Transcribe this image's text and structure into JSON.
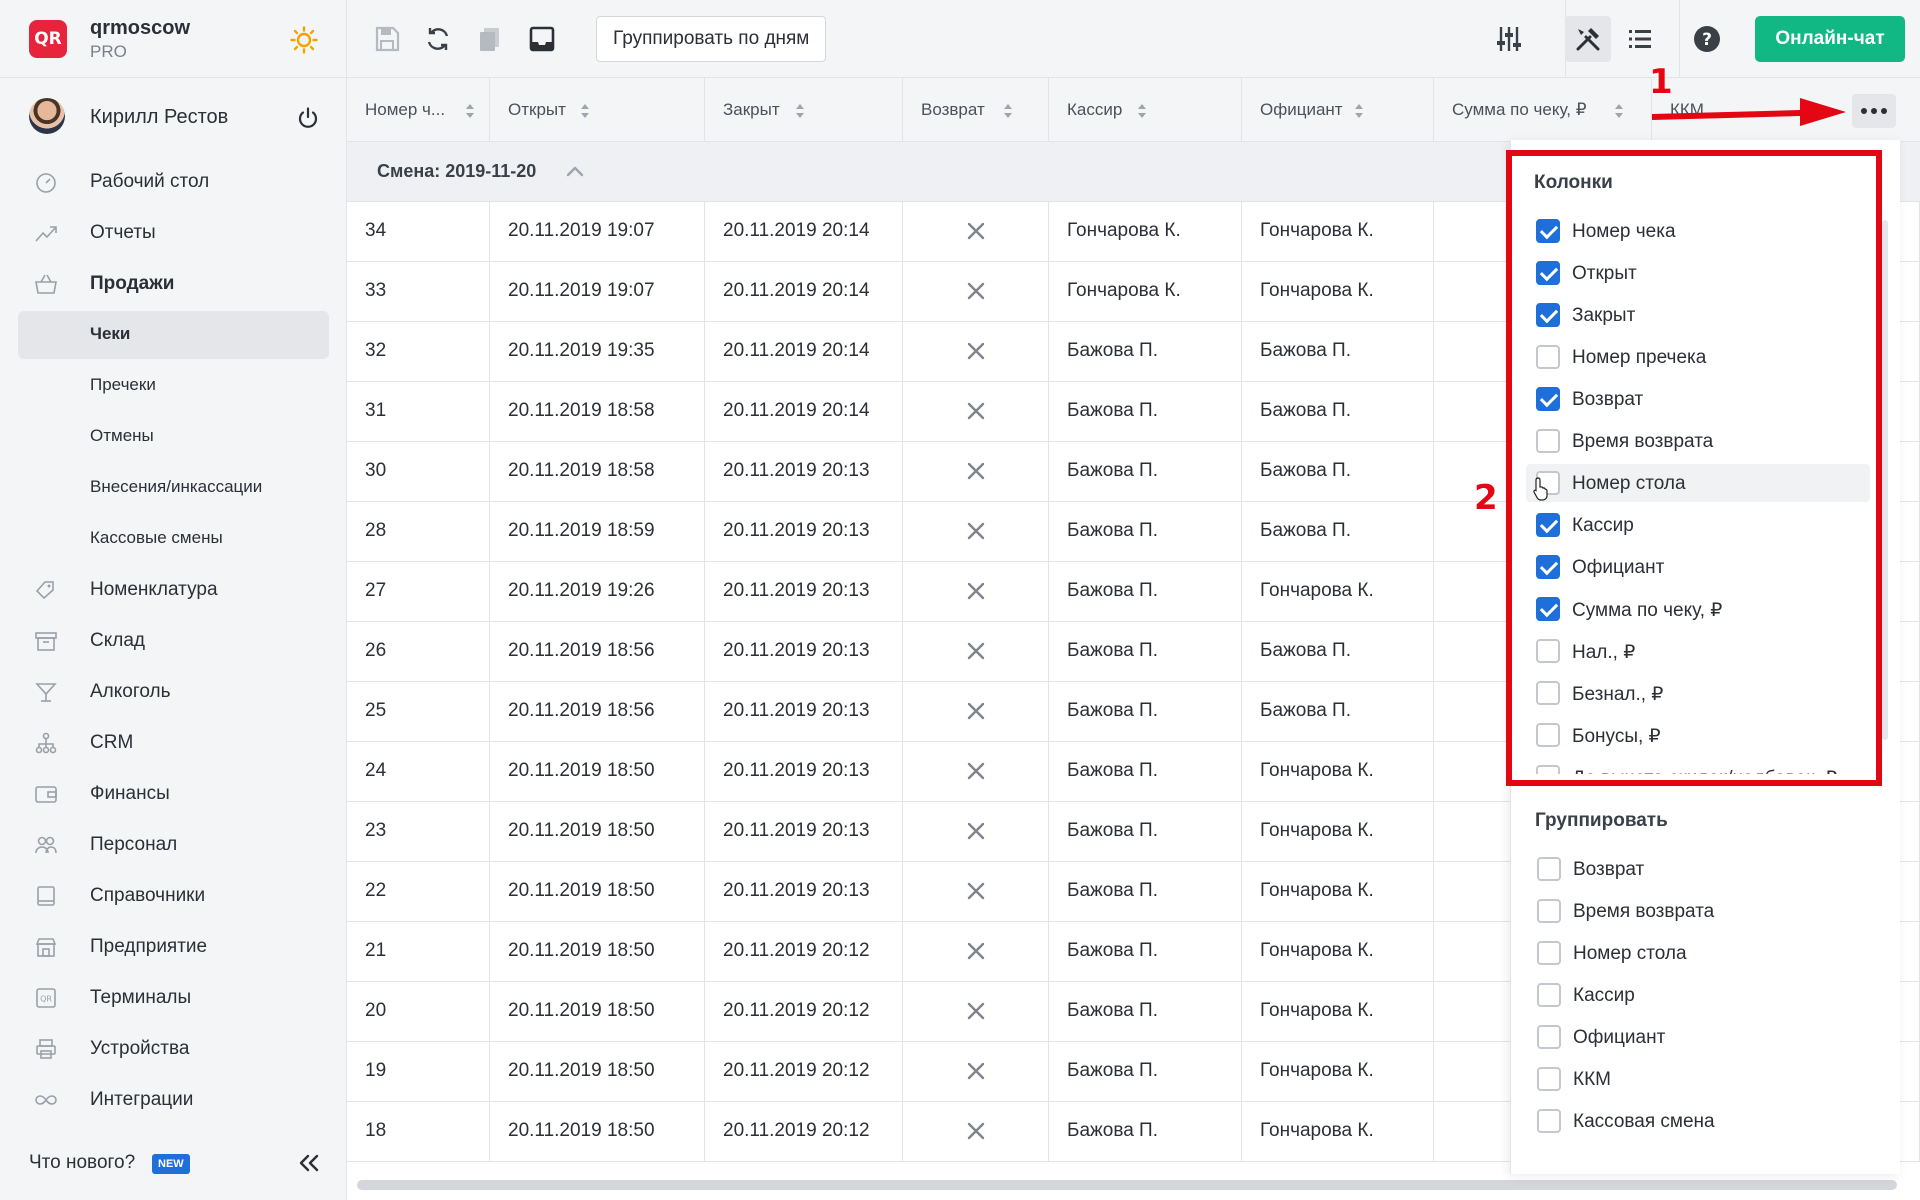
{
  "app": {
    "name": "qrmoscow",
    "plan": "PRO",
    "logo_text": "QR"
  },
  "user": {
    "name": "Кирилл Рестов"
  },
  "nav": {
    "desktop": "Рабочий стол",
    "reports": "Отчеты",
    "sales": "Продажи",
    "sub": [
      "Чеки",
      "Пречеки",
      "Отмены",
      "Внесения/инкассации",
      "Кассовые смены"
    ],
    "rest": [
      "Номенклатура",
      "Склад",
      "Алкоголь",
      "CRM",
      "Финансы",
      "Персонал",
      "Справочники",
      "Предприятие",
      "Терминалы",
      "Устройства",
      "Интеграции"
    ]
  },
  "footer": {
    "whats_new": "Что нового?",
    "badge": "NEW"
  },
  "toolbar": {
    "group_by_days": "Группировать по дням",
    "chat": "Онлайн-чат"
  },
  "table": {
    "columns": [
      "Номер ч...",
      "Открыт",
      "Закрыт",
      "Возврат",
      "Кассир",
      "Официант",
      "Сумма по чеку, ₽",
      "ККМ"
    ],
    "group_label": "Смена: 2019-11-20",
    "rows": [
      {
        "num": "34",
        "open": "20.11.2019 19:07",
        "close": "20.11.2019 20:14",
        "cashier": "Гончарова К.",
        "waiter": "Гончарова К."
      },
      {
        "num": "33",
        "open": "20.11.2019 19:07",
        "close": "20.11.2019 20:14",
        "cashier": "Гончарова К.",
        "waiter": "Гончарова К."
      },
      {
        "num": "32",
        "open": "20.11.2019 19:35",
        "close": "20.11.2019 20:14",
        "cashier": "Бажова П.",
        "waiter": "Бажова П."
      },
      {
        "num": "31",
        "open": "20.11.2019 18:58",
        "close": "20.11.2019 20:14",
        "cashier": "Бажова П.",
        "waiter": "Бажова П."
      },
      {
        "num": "30",
        "open": "20.11.2019 18:58",
        "close": "20.11.2019 20:13",
        "cashier": "Бажова П.",
        "waiter": "Бажова П."
      },
      {
        "num": "28",
        "open": "20.11.2019 18:59",
        "close": "20.11.2019 20:13",
        "cashier": "Бажова П.",
        "waiter": "Бажова П."
      },
      {
        "num": "27",
        "open": "20.11.2019 19:26",
        "close": "20.11.2019 20:13",
        "cashier": "Бажова П.",
        "waiter": "Гончарова К."
      },
      {
        "num": "26",
        "open": "20.11.2019 18:56",
        "close": "20.11.2019 20:13",
        "cashier": "Бажова П.",
        "waiter": "Бажова П."
      },
      {
        "num": "25",
        "open": "20.11.2019 18:56",
        "close": "20.11.2019 20:13",
        "cashier": "Бажова П.",
        "waiter": "Бажова П."
      },
      {
        "num": "24",
        "open": "20.11.2019 18:50",
        "close": "20.11.2019 20:13",
        "cashier": "Бажова П.",
        "waiter": "Гончарова К."
      },
      {
        "num": "23",
        "open": "20.11.2019 18:50",
        "close": "20.11.2019 20:13",
        "cashier": "Бажова П.",
        "waiter": "Гончарова К."
      },
      {
        "num": "22",
        "open": "20.11.2019 18:50",
        "close": "20.11.2019 20:13",
        "cashier": "Бажова П.",
        "waiter": "Гончарова К."
      },
      {
        "num": "21",
        "open": "20.11.2019 18:50",
        "close": "20.11.2019 20:12",
        "cashier": "Бажова П.",
        "waiter": "Гончарова К."
      },
      {
        "num": "20",
        "open": "20.11.2019 18:50",
        "close": "20.11.2019 20:12",
        "cashier": "Бажова П.",
        "waiter": "Гончарова К."
      },
      {
        "num": "19",
        "open": "20.11.2019 18:50",
        "close": "20.11.2019 20:12",
        "cashier": "Бажова П.",
        "waiter": "Гончарова К."
      },
      {
        "num": "18",
        "open": "20.11.2019 18:50",
        "close": "20.11.2019 20:12",
        "cashier": "Бажова П.",
        "waiter": "Гончарова К."
      }
    ]
  },
  "dropdown": {
    "columns_title": "Колонки",
    "columns": [
      {
        "label": "Номер чека",
        "checked": true
      },
      {
        "label": "Открыт",
        "checked": true
      },
      {
        "label": "Закрыт",
        "checked": true
      },
      {
        "label": "Номер пречека",
        "checked": false
      },
      {
        "label": "Возврат",
        "checked": true
      },
      {
        "label": "Время возврата",
        "checked": false
      },
      {
        "label": "Номер стола",
        "checked": false
      },
      {
        "label": "Кассир",
        "checked": true
      },
      {
        "label": "Официант",
        "checked": true
      },
      {
        "label": "Сумма по чеку, ₽",
        "checked": true
      },
      {
        "label": "Нал., ₽",
        "checked": false
      },
      {
        "label": "Безнал., ₽",
        "checked": false
      },
      {
        "label": "Бонусы, ₽",
        "checked": false
      },
      {
        "label": "До вычета скидок/надбавок, ₽",
        "checked": false
      }
    ],
    "group_title": "Группировать",
    "group": [
      {
        "label": "Возврат",
        "checked": false
      },
      {
        "label": "Время возврата",
        "checked": false
      },
      {
        "label": "Номер стола",
        "checked": false
      },
      {
        "label": "Кассир",
        "checked": false
      },
      {
        "label": "Официант",
        "checked": false
      },
      {
        "label": "ККМ",
        "checked": false
      },
      {
        "label": "Кассовая смена",
        "checked": false
      }
    ]
  },
  "annotations": {
    "step1": "1",
    "step2": "2"
  },
  "colors": {
    "accent": "#1e6fd9",
    "chat": "#11b883",
    "annotation": "#e30613",
    "logo": "#e8243c"
  }
}
